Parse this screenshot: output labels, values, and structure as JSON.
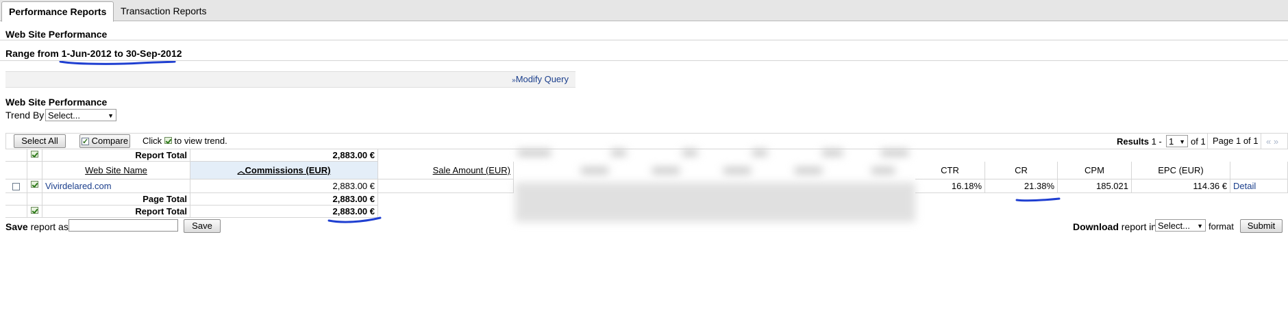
{
  "tabs": {
    "active": "Performance Reports",
    "inactive": "Transaction Reports"
  },
  "section_title": "Web Site Performance",
  "range": {
    "text": "Range from 1-Jun-2012 to 30-Sep-2012"
  },
  "modify_query": "Modify Query",
  "trend": {
    "title": "Web Site Performance",
    "label": "Trend By",
    "selected": "Select..."
  },
  "toolbar": {
    "select_all": "Select All",
    "compare": "Compare",
    "hint_prefix": "Click",
    "hint_suffix": "to view trend.",
    "results_label": "Results",
    "results_range_prefix": "1 -",
    "results_select": "1",
    "results_of": "of 1",
    "page_info": "Page 1 of 1",
    "nav": "« »"
  },
  "table": {
    "report_total_label": "Report Total",
    "page_total_label": "Page Total",
    "headers": {
      "site": "Web Site Name",
      "commissions": "Commissions (EUR)",
      "sale_amount": "Sale Amount (EUR)",
      "ctr": "CTR",
      "cr": "CR",
      "cpm": "CPM",
      "epc": "EPC (EUR)"
    },
    "row": {
      "site": "Vivirdelared.com",
      "commissions": "2,883.00 €",
      "ctr": "16.18%",
      "cr": "21.38%",
      "cpm": "185.021",
      "epc": "114.36 €",
      "detail": "Detail"
    },
    "report_total_top": "2,883.00 €",
    "page_total": "2,883.00 €",
    "report_total_bottom": "2,883.00 €"
  },
  "footer": {
    "save_bold": "Save",
    "save_rest": "report as",
    "save_button": "Save",
    "download_bold": "Download",
    "download_rest": "report in",
    "download_select": "Select...",
    "format": "format",
    "submit": "Submit"
  },
  "colors": {
    "ink": "#1f3fd1",
    "link": "#1a3e8c"
  }
}
